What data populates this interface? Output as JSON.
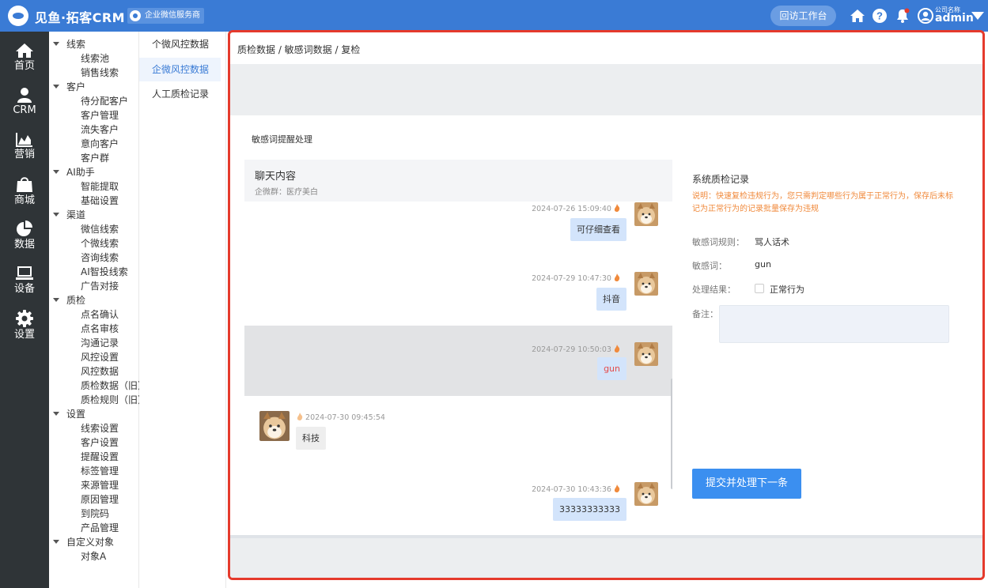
{
  "header": {
    "app_title": "见鱼·拓客CRM",
    "partner_badge": "企业微信服务商",
    "back_button": "回访工作台",
    "company_label": "公司名称",
    "user_name": "admin"
  },
  "sidenav": {
    "items": [
      {
        "label": "首页",
        "icon": "home-icon"
      },
      {
        "label": "CRM",
        "icon": "user-icon"
      },
      {
        "label": "营销",
        "icon": "area-chart-icon"
      },
      {
        "label": "商城",
        "icon": "shopping-bag-icon"
      },
      {
        "label": "数据",
        "icon": "pie-chart-icon"
      },
      {
        "label": "设备",
        "icon": "laptop-icon"
      },
      {
        "label": "设置",
        "icon": "gear-icon"
      }
    ]
  },
  "tree": {
    "groups": [
      {
        "label": "线索",
        "children": [
          "线索池",
          "销售线索"
        ]
      },
      {
        "label": "客户",
        "children": [
          "待分配客户",
          "客户管理",
          "流失客户",
          "意向客户",
          "客户群"
        ]
      },
      {
        "label": "AI助手",
        "children": [
          "智能提取",
          "基础设置"
        ]
      },
      {
        "label": "渠道",
        "children": [
          "微信线索",
          "个微线索",
          "咨询线索",
          "AI智投线索",
          "广告对接"
        ]
      },
      {
        "label": "质检",
        "children": [
          "点名确认",
          "点名审核",
          "沟通记录",
          "风控设置",
          "风控数据",
          "质检数据（旧）",
          "质检规则（旧）"
        ]
      },
      {
        "label": "设置",
        "children": [
          "线索设置",
          "客户设置",
          "提醒设置",
          "标签管理",
          "来源管理",
          "原因管理",
          "到院码",
          "产品管理"
        ]
      },
      {
        "label": "自定义对象",
        "children": [
          "对象A"
        ]
      }
    ]
  },
  "submenu": {
    "items": [
      "个微风控数据",
      "企微风控数据",
      "人工质检记录"
    ],
    "active_index": 1
  },
  "breadcrumb": "质检数据 / 敏感词数据 / 复检",
  "section_title": "敏感词提醒处理",
  "chat": {
    "title": "聊天内容",
    "subtitle": "企微群：医疗美白",
    "messages": [
      {
        "time": "2024-07-26 15:09:40",
        "text": "可仔细查看",
        "side": "right"
      },
      {
        "time": "2024-07-29 10:47:30",
        "text": "抖音",
        "side": "right"
      },
      {
        "time": "2024-07-29 10:50:03",
        "text": "gun",
        "side": "right",
        "highlight": true
      },
      {
        "time": "2024-07-30 09:45:54",
        "text": "科技",
        "side": "left"
      },
      {
        "time": "2024-07-30 10:43:36",
        "text": "33333333333",
        "side": "right"
      }
    ]
  },
  "form": {
    "title": "系统质检记录",
    "note": "说明：快速复检违规行为，您只需判定哪些行为属于正常行为，保存后未标记为正常行为的记录批量保存为违规",
    "rule_label": "敏感词规则：",
    "rule_value": "骂人话术",
    "word_label": "敏感词：",
    "word_value": "gun",
    "result_label": "处理结果：",
    "normal_option": "正常行为",
    "remark_label": "备注：",
    "submit": "提交并处理下一条"
  },
  "colors": {
    "brand": "#3a7bd5",
    "highlight_border": "#e53a2c",
    "warning_text": "#f08a3c",
    "primary_button": "#3b8ff0"
  }
}
